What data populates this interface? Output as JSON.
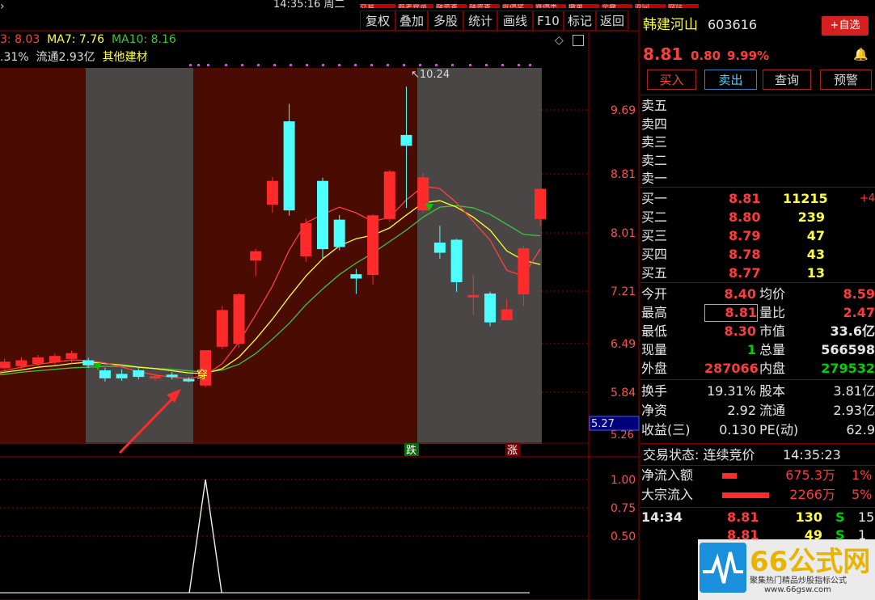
{
  "header": {
    "clock_fragment": "14:35:16",
    "clock_suffix": "周二",
    "top_tabs": [
      "交易",
      "参考登录",
      "融资查",
      "融资查",
      "张停奖",
      "跌停类",
      "撤单",
      "全撤",
      "返回",
      "网站"
    ]
  },
  "toolbar": {
    "buttons": [
      "复权",
      "叠加",
      "多股",
      "统计",
      "画线",
      "F10",
      "标记",
      "返回"
    ]
  },
  "info_line": {
    "ma5": "3: 8.03",
    "ma7": "MA7: 7.76",
    "ma10": "MA10: 8.16",
    "turnover": ".31%",
    "float_label": "流通2.93亿",
    "sector": "其他建材"
  },
  "price_axis": {
    "ticks": [
      "9.69",
      "8.81",
      "8.01",
      "7.21",
      "6.49",
      "5.84",
      "5.27"
    ],
    "current_marker": "5.27",
    "cut_label": "5.26"
  },
  "indicator_axis": {
    "ticks": [
      "1.00",
      "0.75",
      "0.50"
    ]
  },
  "annotations": {
    "high_label": "10.24",
    "signal": "穿",
    "fall_badge": "跌",
    "rise_badge": "涨"
  },
  "colors": {
    "up": "#ff2a2a",
    "down": "#4dffff",
    "ma_short": "#ff4040",
    "ma_mid": "#ffff30",
    "ma_long": "#3ec43e",
    "band_red": "#4a0b02",
    "band_gray": "#4b4646",
    "axis_red": "#9b0000"
  },
  "chart_data": {
    "type": "candlestick",
    "ylim": [
      5.26,
      10.5
    ],
    "candles": [
      {
        "o": 6.3,
        "c": 6.35,
        "h": 6.42,
        "l": 6.2
      },
      {
        "o": 6.32,
        "c": 6.4,
        "h": 6.45,
        "l": 6.28
      },
      {
        "o": 6.35,
        "c": 6.42,
        "h": 6.47,
        "l": 6.3
      },
      {
        "o": 6.38,
        "c": 6.46,
        "h": 6.5,
        "l": 6.33
      },
      {
        "o": 6.4,
        "c": 6.48,
        "h": 6.52,
        "l": 6.36
      },
      {
        "o": 6.45,
        "c": 6.52,
        "h": 6.56,
        "l": 6.38
      },
      {
        "o": 6.42,
        "c": 6.36,
        "h": 6.46,
        "l": 6.32
      },
      {
        "o": 6.28,
        "c": 6.18,
        "h": 6.32,
        "l": 6.13
      },
      {
        "o": 6.23,
        "c": 6.18,
        "h": 6.3,
        "l": 6.14
      },
      {
        "o": 6.28,
        "c": 6.2,
        "h": 6.34,
        "l": 6.16
      },
      {
        "o": 6.2,
        "c": 6.2,
        "h": 6.24,
        "l": 6.14
      },
      {
        "o": 6.22,
        "c": 6.2,
        "h": 6.26,
        "l": 6.16
      },
      {
        "o": 6.16,
        "c": 6.15,
        "h": 6.19,
        "l": 6.12
      },
      {
        "o": 6.08,
        "c": 6.56,
        "h": 6.56,
        "l": 6.05
      },
      {
        "o": 6.62,
        "c": 7.12,
        "h": 7.18,
        "l": 6.58
      },
      {
        "o": 6.66,
        "c": 7.34,
        "h": 7.36,
        "l": 6.6
      },
      {
        "o": 7.82,
        "c": 7.94,
        "h": 7.98,
        "l": 7.6
      },
      {
        "o": 8.6,
        "c": 8.92,
        "h": 8.98,
        "l": 8.48
      },
      {
        "o": 9.75,
        "c": 8.52,
        "h": 10.0,
        "l": 8.44
      },
      {
        "o": 7.88,
        "c": 8.33,
        "h": 8.4,
        "l": 7.8
      },
      {
        "o": 8.92,
        "c": 7.98,
        "h": 8.97,
        "l": 7.85
      },
      {
        "o": 8.38,
        "c": 8.01,
        "h": 8.45,
        "l": 7.96
      },
      {
        "o": 7.62,
        "c": 7.57,
        "h": 7.7,
        "l": 7.35
      },
      {
        "o": 7.62,
        "c": 8.44,
        "h": 8.46,
        "l": 7.48
      },
      {
        "o": 8.4,
        "c": 9.05,
        "h": 9.08,
        "l": 8.36
      },
      {
        "o": 9.56,
        "c": 9.42,
        "h": 10.24,
        "l": 8.55
      },
      {
        "o": 8.52,
        "c": 8.97,
        "h": 9.04,
        "l": 8.48
      },
      {
        "o": 8.06,
        "c": 7.93,
        "h": 8.3,
        "l": 7.84
      },
      {
        "o": 8.1,
        "c": 7.52,
        "h": 8.12,
        "l": 7.38
      },
      {
        "o": 7.33,
        "c": 7.33,
        "h": 7.62,
        "l": 7.06
      },
      {
        "o": 7.35,
        "c": 6.96,
        "h": 7.38,
        "l": 6.9
      },
      {
        "o": 6.99,
        "c": 7.13,
        "h": 7.28,
        "l": 6.98
      },
      {
        "o": 7.35,
        "c": 7.98,
        "h": 8.02,
        "l": 7.18
      },
      {
        "o": 8.4,
        "c": 8.81,
        "h": 8.81,
        "l": 8.3
      }
    ],
    "ma_short": [
      6.24,
      6.28,
      6.33,
      6.37,
      6.4,
      6.43,
      6.42,
      6.39,
      6.33,
      6.27,
      6.22,
      6.19,
      6.17,
      6.22,
      6.38,
      6.68,
      7.06,
      7.46,
      7.96,
      8.34,
      8.46,
      8.56,
      8.48,
      8.36,
      8.42,
      8.66,
      8.85,
      8.82,
      8.62,
      8.36,
      8.1,
      7.68,
      7.6,
      7.98
    ],
    "ma_mid": [
      6.22,
      6.26,
      6.29,
      6.33,
      6.35,
      6.38,
      6.4,
      6.38,
      6.36,
      6.33,
      6.31,
      6.28,
      6.25,
      6.24,
      6.31,
      6.47,
      6.72,
      7.0,
      7.31,
      7.6,
      7.84,
      8.02,
      8.12,
      8.17,
      8.27,
      8.45,
      8.62,
      8.65,
      8.56,
      8.42,
      8.24,
      7.95,
      7.82,
      7.76
    ],
    "ma_long": [
      6.2,
      6.23,
      6.26,
      6.28,
      6.3,
      6.32,
      6.33,
      6.34,
      6.34,
      6.33,
      6.31,
      6.3,
      6.28,
      6.26,
      6.29,
      6.37,
      6.52,
      6.72,
      6.94,
      7.2,
      7.42,
      7.62,
      7.78,
      7.92,
      8.08,
      8.24,
      8.42,
      8.56,
      8.58,
      8.55,
      8.46,
      8.32,
      8.18,
      8.16
    ],
    "indicator": {
      "ylim": [
        0,
        1.2
      ],
      "values": [
        0,
        0,
        0,
        0,
        0,
        0,
        0,
        0,
        0,
        0,
        0,
        0,
        0,
        1.0,
        0,
        0,
        0,
        0,
        0,
        0,
        0,
        0,
        0,
        0,
        0,
        0,
        0,
        0,
        0,
        0,
        0,
        0,
        0,
        0
      ]
    }
  },
  "quote": {
    "name": "韩建河山",
    "code": "603616",
    "watch_button": "+自选",
    "price": "8.81",
    "change": "0.80",
    "change_pct": "9.99%",
    "actions": [
      "买入",
      "卖出",
      "查询",
      "预警"
    ],
    "asks": [
      "卖五",
      "卖四",
      "卖三",
      "卖二",
      "卖一"
    ],
    "bids": [
      {
        "label": "买一",
        "price": "8.81",
        "vol": "11215",
        "extra": "+4"
      },
      {
        "label": "买二",
        "price": "8.80",
        "vol": "239",
        "extra": ""
      },
      {
        "label": "买三",
        "price": "8.79",
        "vol": "47",
        "extra": ""
      },
      {
        "label": "买四",
        "price": "8.78",
        "vol": "43",
        "extra": ""
      },
      {
        "label": "买五",
        "price": "8.77",
        "vol": "13",
        "extra": ""
      }
    ],
    "stats_left": [
      {
        "label": "今开",
        "value": "8.40"
      },
      {
        "label": "最高",
        "value": "8.81"
      },
      {
        "label": "最低",
        "value": "8.30"
      },
      {
        "label": "现量",
        "value": "1"
      },
      {
        "label": "外盘",
        "value": "287066"
      }
    ],
    "stats_right": [
      {
        "label": "均价",
        "value": "8.59"
      },
      {
        "label": "量比",
        "value": "2.47"
      },
      {
        "label": "市值",
        "value": "33.6亿"
      },
      {
        "label": "总量",
        "value": "566598"
      },
      {
        "label": "内盘",
        "value": "279532"
      }
    ],
    "fund_left": [
      {
        "label": "换手",
        "value": "19.31%"
      },
      {
        "label": "净资",
        "value": "2.92"
      },
      {
        "label": "收益(三)",
        "value": "0.130"
      }
    ],
    "fund_right": [
      {
        "label": "股本",
        "value": "3.81亿"
      },
      {
        "label": "流通",
        "value": "2.93亿"
      },
      {
        "label": "PE(动)",
        "value": "62.9"
      }
    ],
    "status_label": "交易状态: 连续竞价",
    "status_time": "14:35:23",
    "flows": [
      {
        "label": "净流入额",
        "value": "675.3万",
        "pct": "1%",
        "fill": 0.25
      },
      {
        "label": "大宗流入",
        "value": "2266万",
        "pct": "5%",
        "fill": 0.8
      }
    ],
    "ticks": [
      {
        "time": "14:34",
        "price": "8.81",
        "vol": "130",
        "flag": "S",
        "n": "15"
      },
      {
        "time": "",
        "price": "8.81",
        "vol": "49",
        "flag": "S",
        "n": "1"
      }
    ]
  },
  "watermark": {
    "brand": "66公式网",
    "tagline": "聚集热门精品炒股指标公式",
    "url": "www.66gsw.com"
  }
}
